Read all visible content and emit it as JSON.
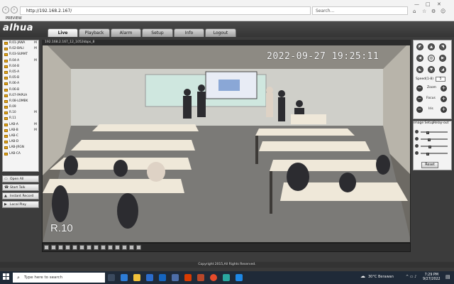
{
  "browser": {
    "address": "http://192.168.2.167/",
    "search_placeholder": "Search...",
    "tab_title": "PREVIEW"
  },
  "app": {
    "logo": "alhua",
    "tabs": [
      "Live",
      "Playback",
      "Alarm",
      "Setup",
      "Info",
      "Logout"
    ],
    "active_tab": "Live",
    "stream_info": "192.168.2.167_12_1052kbps_8",
    "channels": [
      {
        "name": "R.01-JAWA",
        "mark": "M"
      },
      {
        "name": "R.02-BALI",
        "mark": "M"
      },
      {
        "name": "R.03-SUMAT",
        "mark": ""
      },
      {
        "name": "R.04-A",
        "mark": "M"
      },
      {
        "name": "R.04-B",
        "mark": ""
      },
      {
        "name": "R.05-A",
        "mark": ""
      },
      {
        "name": "R.05-B",
        "mark": ""
      },
      {
        "name": "R.06-A",
        "mark": ""
      },
      {
        "name": "R.06-B",
        "mark": ""
      },
      {
        "name": "R.07-PAPUA",
        "mark": ""
      },
      {
        "name": "R.08-LOMBK",
        "mark": ""
      },
      {
        "name": "R.09",
        "mark": ""
      },
      {
        "name": "R.10",
        "mark": "M"
      },
      {
        "name": "R.11",
        "mark": ""
      },
      {
        "name": "LAB-A",
        "mark": "M"
      },
      {
        "name": "LAB-B",
        "mark": "M"
      },
      {
        "name": "LAB-C",
        "mark": ""
      },
      {
        "name": "LAB-D",
        "mark": ""
      },
      {
        "name": "LAB-JRGN",
        "mark": ""
      },
      {
        "name": "LAB-CA",
        "mark": ""
      }
    ],
    "left_buttons": [
      "Open All",
      "Start Talk",
      "Instant Record",
      "Local Play"
    ],
    "osd_datetime": "2022-09-27 19:25:11",
    "osd_label": "R.10",
    "ptz": {
      "speed_label": "Speed(1-8)",
      "speed_value": "5",
      "zoom_label": "Zoom",
      "focus_label": "Focus",
      "iris_label": "Iris"
    },
    "image_setup": {
      "tab1": "Image Setup",
      "tab2": "Relay-out",
      "reset_label": "Reset",
      "slider_levels": [
        0.2,
        0.25,
        0.3,
        0.2
      ]
    },
    "copyright": "Copyright 2015,All Rights Reserved."
  },
  "taskbar": {
    "search_placeholder": "Type here to search",
    "weather": "30°C  Berawan",
    "time": "7:29 PM",
    "date": "9/27/2022"
  }
}
